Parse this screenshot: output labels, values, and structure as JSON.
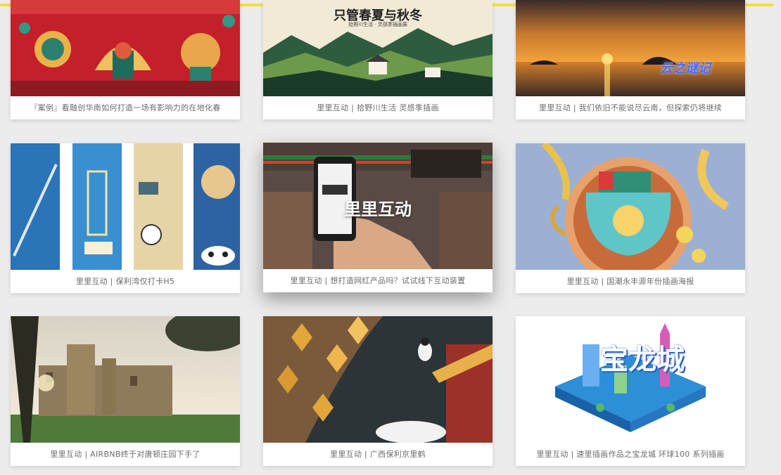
{
  "cards": [
    {
      "caption": "『案例』看融创华南如何打造一场有影响力的在地化春"
    },
    {
      "caption": "里里互动 | 拾野川生活 灵感季插画",
      "poster_title": "只管春夏与秋冬",
      "poster_sub": "拾野川生活 · 灵感季插画展"
    },
    {
      "caption": "里里互动 | 我们依旧不能说尽云南，但探索仍将继续",
      "stamp": "云之谜记"
    },
    {
      "caption": "里里互动 | 保利湾仅打卡H5"
    },
    {
      "caption": "里里互动 | 想打造网红产品吗？试试线下互动装置",
      "overlay": "里里互动"
    },
    {
      "caption": "里里互动 | 国潮永丰源年份插画海报"
    },
    {
      "caption": "里里互动 | AIRBNB终于对唐顿庄园下手了"
    },
    {
      "caption": "里里互动 | 广西保利京里鹤"
    },
    {
      "caption": "里里互动 | 速里插画作品之宝龙城 环球100 系列插画",
      "art_title": "宝龙城"
    }
  ],
  "colors": {
    "accent_bar": "#f3df3f",
    "background": "#ececec",
    "caption_text": "#6b6b6b"
  }
}
